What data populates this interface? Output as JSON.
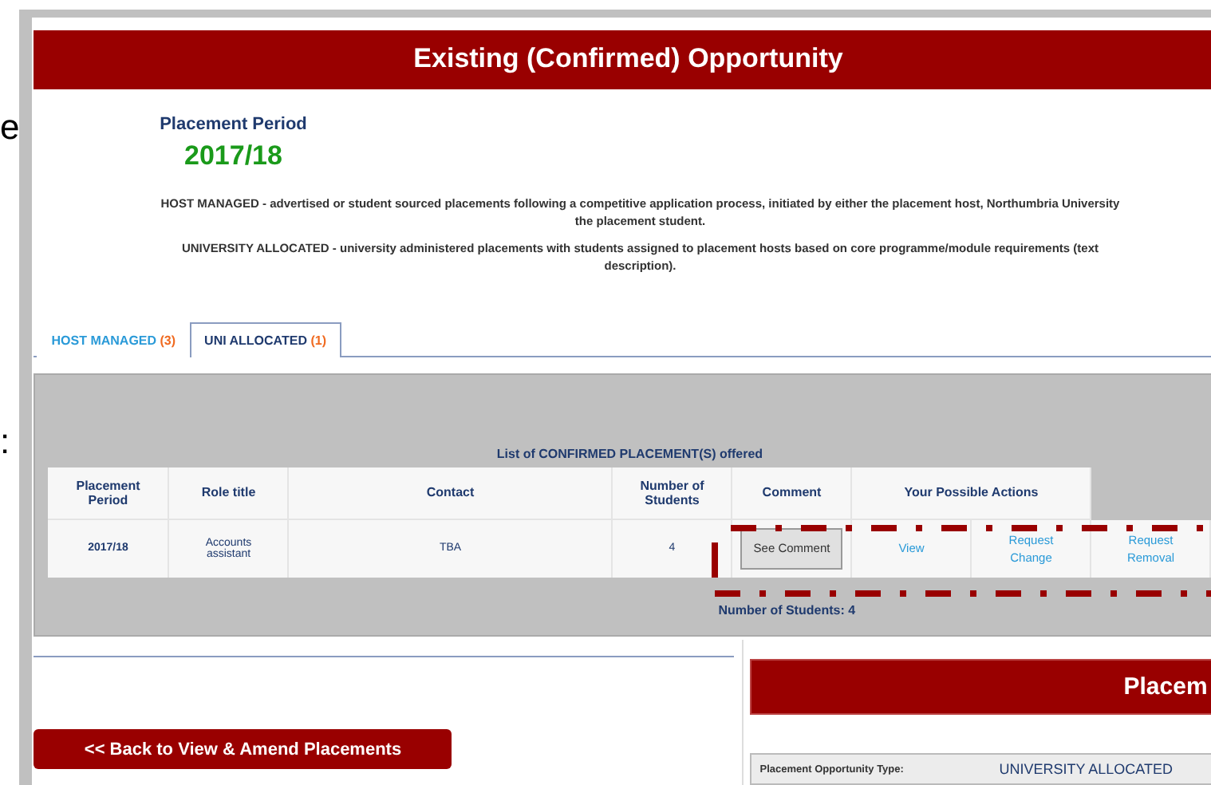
{
  "background_fragments": [
    "e",
    ":"
  ],
  "header": {
    "title": "Existing (Confirmed) Opportunity"
  },
  "period": {
    "label": "Placement Period",
    "value": "2017/18"
  },
  "descriptions": [
    [
      "HOST MANAGED - advertised or student sourced placements following a competitive application process, initiated by either the placement host, Northumbria University",
      "the placement student."
    ],
    [
      "UNIVERSITY ALLOCATED - university administered placements with students assigned to placement hosts based on core programme/module requirements (text",
      "description)."
    ]
  ],
  "tabs": [
    {
      "label": "HOST MANAGED",
      "count": "(3)",
      "selected": false
    },
    {
      "label": "UNI ALLOCATED",
      "count": "(1)",
      "selected": true
    }
  ],
  "list_caption": "List of **CONFIRMED PLACEMENT(S)** offered",
  "table": {
    "columns": [
      "Placement Period",
      "Role title",
      "Contact",
      "Number of Students",
      "Comment",
      "Your Possible Actions"
    ],
    "rows": [
      {
        "cells": [
          "2017/18",
          "Accounts assistant",
          "TBA",
          "4"
        ],
        "comment_button": "See Comment",
        "actions": [
          "View",
          "Request Change",
          "Request Removal"
        ]
      }
    ]
  },
  "total": "Number of Students: 4",
  "back_button": "<< Back to View & Amend Placements",
  "detail_panel": {
    "title": "Placem",
    "type_label": "Placement Opportunity Type:",
    "type_value": "UNIVERSITY ALLOCATED"
  }
}
